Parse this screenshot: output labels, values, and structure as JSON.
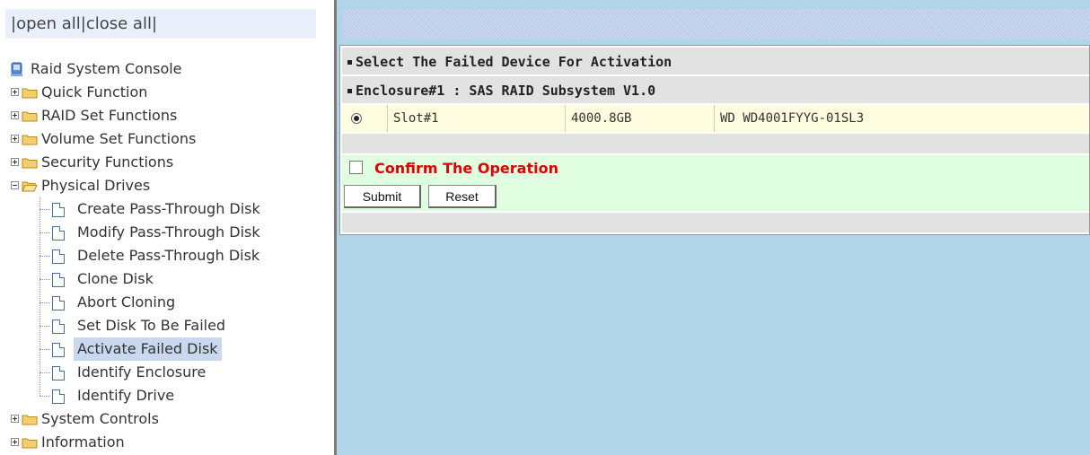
{
  "left": {
    "open_all": "open all",
    "close_all": "close all",
    "separator_left": "|",
    "separator_mid": "|",
    "separator_right": "|"
  },
  "tree": {
    "root": "Raid System Console",
    "items": [
      {
        "label": "Quick Function",
        "type": "folder",
        "expanded": false
      },
      {
        "label": "RAID Set Functions",
        "type": "folder",
        "expanded": false
      },
      {
        "label": "Volume Set Functions",
        "type": "folder",
        "expanded": false
      },
      {
        "label": "Security Functions",
        "type": "folder",
        "expanded": false
      },
      {
        "label": "Physical Drives",
        "type": "folder",
        "expanded": true
      },
      {
        "label": "Create Pass-Through Disk",
        "type": "page"
      },
      {
        "label": "Modify Pass-Through Disk",
        "type": "page"
      },
      {
        "label": "Delete Pass-Through Disk",
        "type": "page"
      },
      {
        "label": "Clone Disk",
        "type": "page"
      },
      {
        "label": "Abort Cloning",
        "type": "page"
      },
      {
        "label": "Set Disk To Be Failed",
        "type": "page"
      },
      {
        "label": "Activate Failed Disk",
        "type": "page",
        "selected": true
      },
      {
        "label": "Identify Enclosure",
        "type": "page"
      },
      {
        "label": "Identify Drive",
        "type": "page"
      },
      {
        "label": "System Controls",
        "type": "folder",
        "expanded": false
      },
      {
        "label": "Information",
        "type": "folder",
        "expanded": false
      }
    ]
  },
  "main": {
    "section_title": "Select The Failed Device For Activation",
    "enclosure_title": "Enclosure#1 : SAS RAID Subsystem V1.0",
    "device": {
      "slot": "Slot#1",
      "capacity": "4000.8GB",
      "model": "WD WD4001FYYG-01SL3",
      "selected": true
    },
    "confirm_label": "Confirm The Operation",
    "confirm_checked": false,
    "submit_label": "Submit",
    "reset_label": "Reset"
  },
  "colors": {
    "content_bg": "#b0d4e8",
    "confirm_text": "#e00000",
    "selected_row_bg": "#fffde0",
    "confirm_row_bg": "#dfffe0",
    "tree_selected_bg": "#c9d8ee"
  }
}
